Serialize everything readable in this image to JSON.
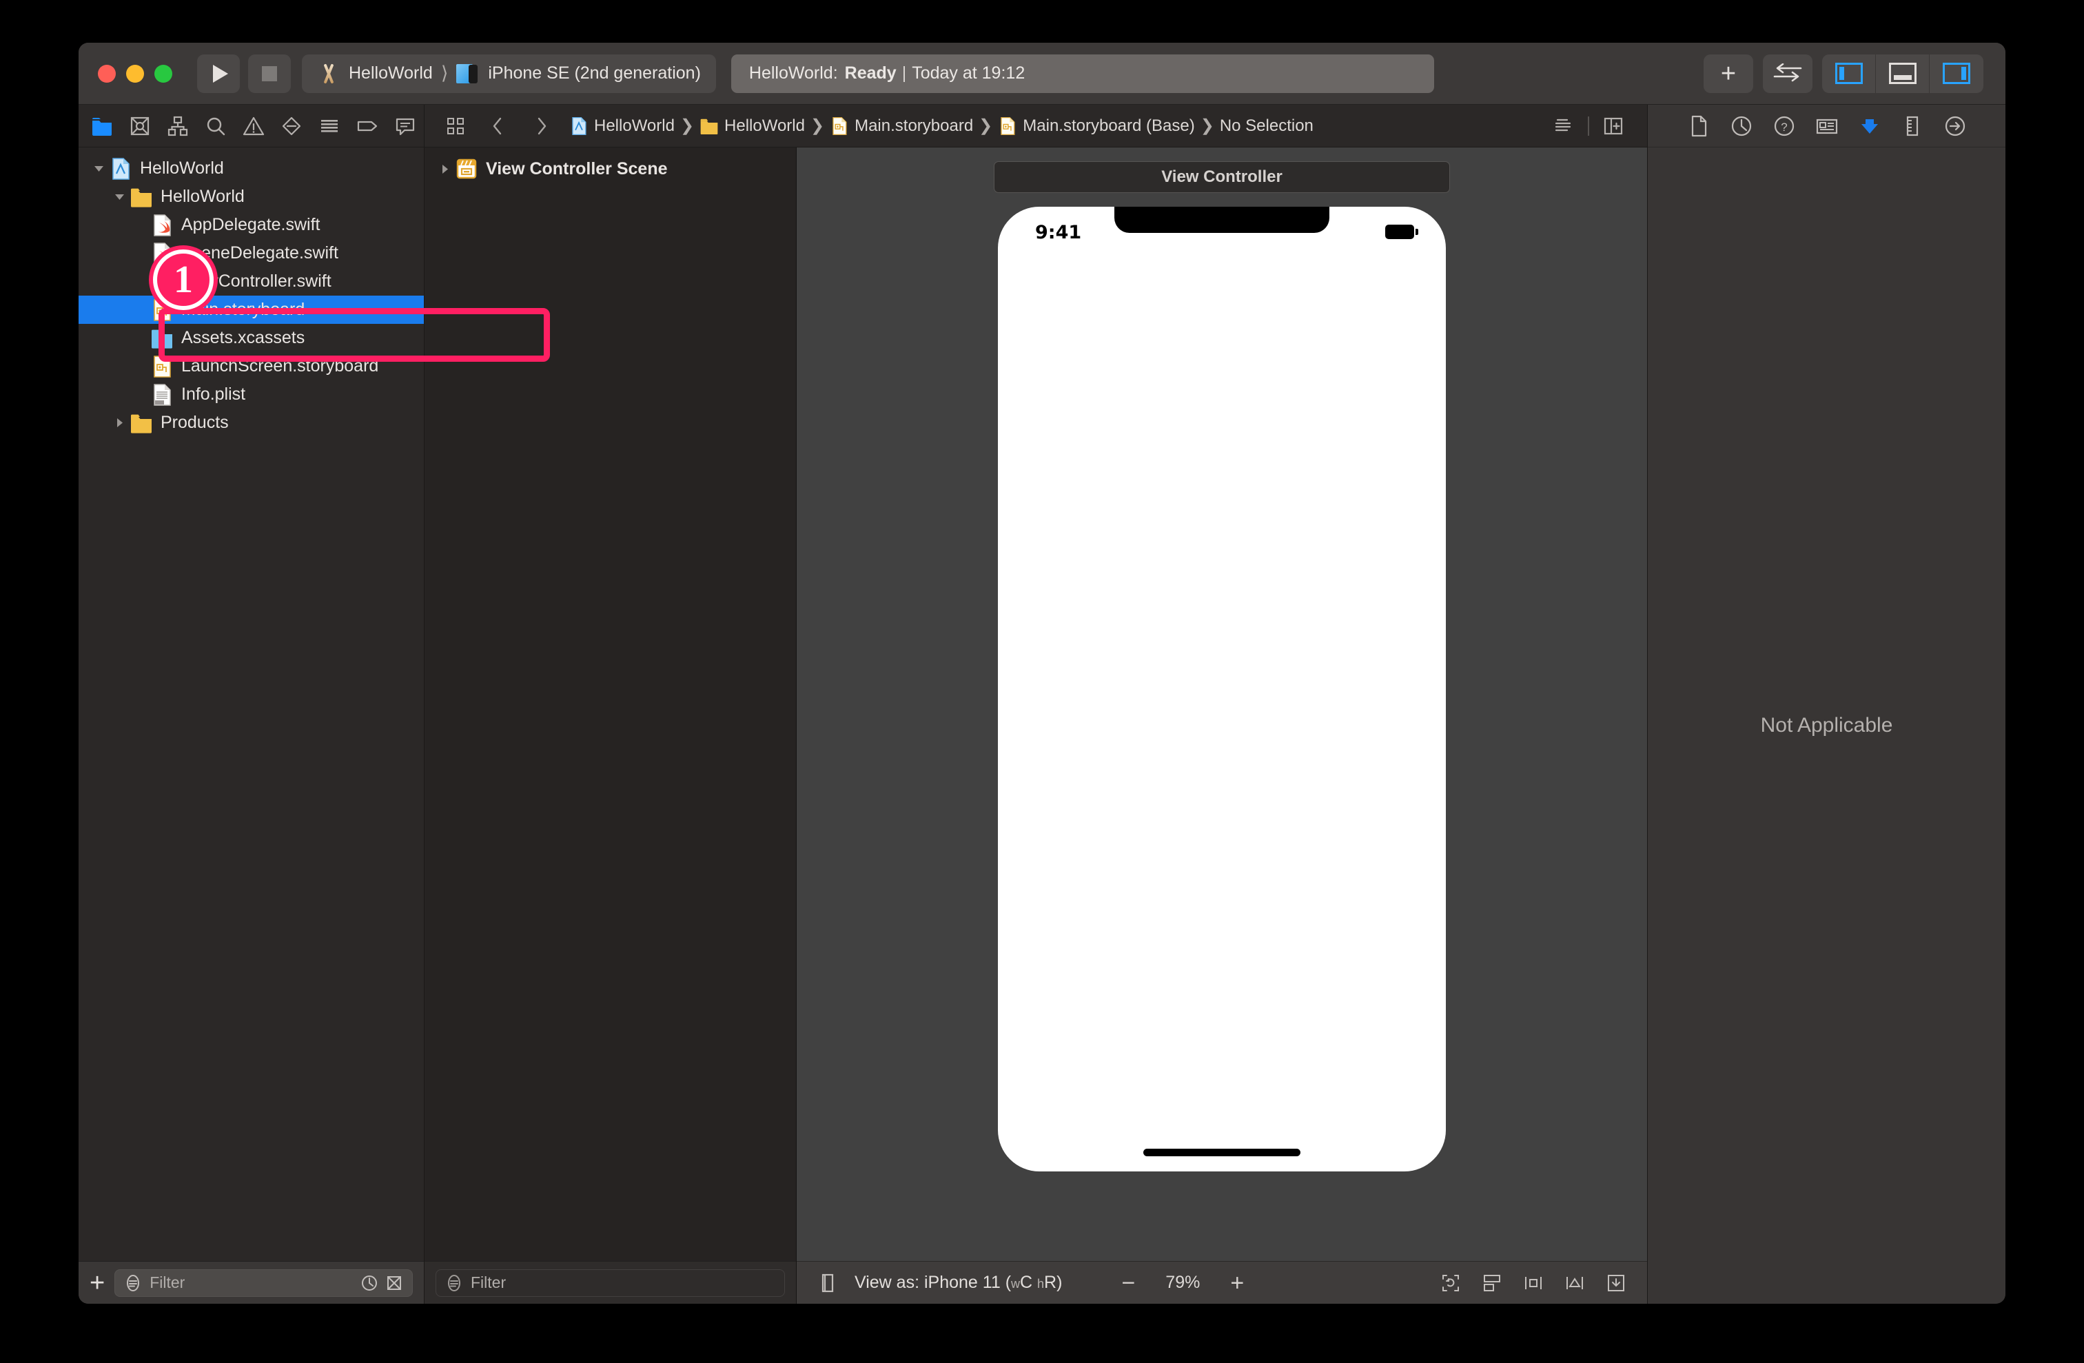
{
  "window": {
    "title": "HelloWorld"
  },
  "toolbar": {
    "run_label": "Run",
    "stop_label": "Stop",
    "scheme_name": "HelloWorld",
    "destination_name": "iPhone SE (2nd generation)",
    "status_project": "HelloWorld:",
    "status_state": "Ready",
    "status_divider": "|",
    "status_time": "Today at 19:12",
    "add_label": "+",
    "swap_label": "Adjust Editor Options",
    "pane_left_label": "Hide or show the Navigator",
    "pane_bottom_label": "Hide or show the Debug area",
    "pane_right_label": "Hide or show the Inspectors",
    "accent_blue": "#29a3ff"
  },
  "navigator": {
    "toolbar_icons": [
      {
        "name": "project-navigator-icon",
        "active": true
      },
      {
        "name": "source-control-navigator-icon",
        "active": false
      },
      {
        "name": "symbol-navigator-icon",
        "active": false
      },
      {
        "name": "find-navigator-icon",
        "active": false
      },
      {
        "name": "issue-navigator-icon",
        "active": false
      },
      {
        "name": "test-navigator-icon",
        "active": false
      },
      {
        "name": "debug-navigator-icon",
        "active": false
      },
      {
        "name": "breakpoint-navigator-icon",
        "active": false
      },
      {
        "name": "report-navigator-icon",
        "active": false
      }
    ],
    "tree": [
      {
        "label": "HelloWorld",
        "indent": 0,
        "icon": "xcode-project-icon",
        "twisty": "down",
        "selected": false
      },
      {
        "label": "HelloWorld",
        "indent": 1,
        "icon": "folder-yellow-icon",
        "twisty": "down",
        "selected": false
      },
      {
        "label": "AppDelegate.swift",
        "indent": 2,
        "icon": "swift-file-icon",
        "twisty": "none",
        "selected": false
      },
      {
        "label": "SceneDelegate.swift",
        "indent": 2,
        "icon": "swift-file-icon",
        "twisty": "none",
        "selected": false
      },
      {
        "label": "ViewController.swift",
        "indent": 2,
        "icon": "swift-file-icon",
        "twisty": "none",
        "selected": false
      },
      {
        "label": "Main.storyboard",
        "indent": 2,
        "icon": "storyboard-file-icon",
        "twisty": "none",
        "selected": true
      },
      {
        "label": "Assets.xcassets",
        "indent": 2,
        "icon": "assets-folder-icon",
        "twisty": "none",
        "selected": false
      },
      {
        "label": "LaunchScreen.storyboard",
        "indent": 2,
        "icon": "storyboard-file-icon",
        "twisty": "none",
        "selected": false
      },
      {
        "label": "Info.plist",
        "indent": 2,
        "icon": "plist-file-icon",
        "twisty": "none",
        "selected": false
      },
      {
        "label": "Products",
        "indent": 1,
        "icon": "folder-yellow-icon",
        "twisty": "right",
        "selected": false
      }
    ],
    "filter_placeholder": "Filter",
    "add_button_label": "+"
  },
  "breadcrumb": {
    "back_label": "Back",
    "forward_label": "Forward",
    "items": [
      {
        "label": "HelloWorld",
        "icon": "xcode-project-icon"
      },
      {
        "label": "HelloWorld",
        "icon": "folder-yellow-icon"
      },
      {
        "label": "Main.storyboard",
        "icon": "storyboard-file-icon"
      },
      {
        "label": "Main.storyboard (Base)",
        "icon": "storyboard-file-icon"
      },
      {
        "label": "No Selection",
        "icon": "none"
      }
    ],
    "right_icons": [
      "minimap-icon",
      "add-editor-icon"
    ]
  },
  "outline": {
    "rows": [
      {
        "label": "View Controller Scene",
        "icon": "scene-clapper-icon",
        "twisty": "right"
      }
    ],
    "filter_placeholder": "Filter"
  },
  "canvas": {
    "scene_title": "View Controller",
    "phone": {
      "status_time": "9:41",
      "battery_label": "battery-full-icon"
    },
    "entry_arrow_label": "storyboard-entry-point-arrow"
  },
  "canvas_bottom": {
    "device_icon": "device-orientation-icon",
    "view_as_prefix": "View as:",
    "view_as_device": "iPhone 11",
    "view_as_traits_open": "(",
    "view_as_w": "w",
    "view_as_wclass": "C",
    "view_as_h": "h",
    "view_as_hclass": "R",
    "view_as_traits_close": ")",
    "zoom_out_label": "−",
    "zoom_value": "79%",
    "zoom_in_label": "+",
    "right_icons": [
      "update-frames-icon",
      "embed-in-icon",
      "align-icon",
      "add-constraints-icon",
      "resolve-auto-layout-icon"
    ]
  },
  "inspector": {
    "tabs": [
      {
        "name": "file-inspector-icon",
        "active": false
      },
      {
        "name": "history-inspector-icon",
        "active": false
      },
      {
        "name": "quick-help-inspector-icon",
        "active": false
      },
      {
        "name": "identity-inspector-icon",
        "active": false
      },
      {
        "name": "attributes-inspector-icon",
        "active": true
      },
      {
        "name": "size-inspector-icon",
        "active": false
      },
      {
        "name": "connections-inspector-icon",
        "active": false
      }
    ],
    "empty_message": "Not Applicable"
  },
  "annotation": {
    "badge_number": "1",
    "highlight_target": "Main.storyboard",
    "color": "#ff1f62"
  }
}
